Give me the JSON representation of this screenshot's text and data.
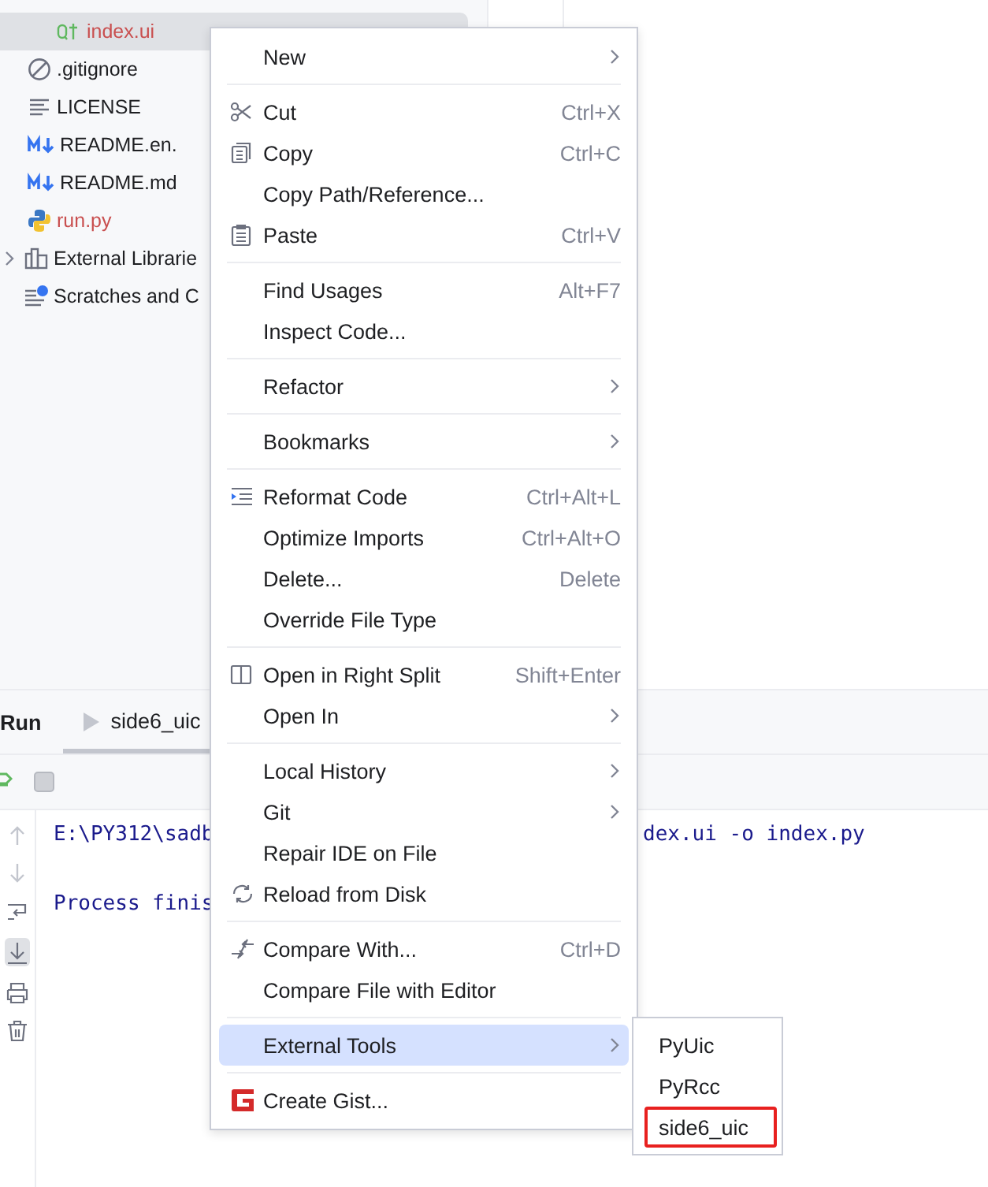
{
  "project_tree": [
    {
      "children": [
        {
          "children": [
            {
              "label": "index.ui",
              "kind": "qt",
              "color": "#c94f4f",
              "selected": true
            }
          ]
        },
        {
          "label": ".gitignore",
          "kind": "ignore",
          "color": "#1e1f22",
          "selected": false
        },
        {
          "label": "LICENSE",
          "kind": "text",
          "color": "#1e1f22",
          "selected": false
        },
        {
          "label": "README.en.",
          "kind": "markdown",
          "color": "#1e1f22",
          "selected": false
        },
        {
          "label": "README.md",
          "kind": "markdown",
          "color": "#1e1f22",
          "selected": false
        },
        {
          "label": "run.py",
          "kind": "python",
          "color": "#c94f4f",
          "selected": false
        }
      ]
    },
    {
      "label": "External Librarie",
      "kind": "libraries",
      "color": "#1e1f22",
      "selected": false,
      "expanded": false
    },
    {
      "label": "Scratches and C",
      "kind": "scratches",
      "color": "#1e1f22",
      "selected": false
    }
  ],
  "run_panel": {
    "title": "Run",
    "tabs": [
      {
        "label": "side6_uic",
        "selected": true
      }
    ],
    "console": [
      {
        "kind": "line",
        "text": "E:\\PY312\\sadb",
        "tail": "dex.ui -o index.py"
      },
      {
        "kind": "blank"
      },
      {
        "kind": "line",
        "text": "Process finis"
      }
    ]
  },
  "context_menu": {
    "items": [
      {
        "kind": "item",
        "label": "New",
        "has_submenu": true,
        "selected": false
      },
      {
        "kind": "separator"
      },
      {
        "kind": "item",
        "label": "Cut",
        "shortcut": "Ctrl+X",
        "selected": false
      },
      {
        "kind": "item",
        "label": "Copy",
        "shortcut": "Ctrl+C",
        "selected": false
      },
      {
        "kind": "item",
        "label": "Copy Path/Reference...",
        "selected": false
      },
      {
        "kind": "item",
        "label": "Paste",
        "shortcut": "Ctrl+V",
        "selected": false
      },
      {
        "kind": "separator"
      },
      {
        "kind": "item",
        "label": "Find Usages",
        "shortcut": "Alt+F7",
        "selected": false
      },
      {
        "kind": "item",
        "label": "Inspect Code...",
        "selected": false
      },
      {
        "kind": "separator"
      },
      {
        "kind": "item",
        "label": "Refactor",
        "has_submenu": true,
        "selected": false
      },
      {
        "kind": "separator"
      },
      {
        "kind": "item",
        "label": "Bookmarks",
        "has_submenu": true,
        "selected": false
      },
      {
        "kind": "separator"
      },
      {
        "kind": "item",
        "label": "Reformat Code",
        "shortcut": "Ctrl+Alt+L",
        "selected": false
      },
      {
        "kind": "item",
        "label": "Optimize Imports",
        "shortcut": "Ctrl+Alt+O",
        "selected": false
      },
      {
        "kind": "item",
        "label": "Delete...",
        "shortcut": "Delete",
        "selected": false
      },
      {
        "kind": "item",
        "label": "Override File Type",
        "selected": false
      },
      {
        "kind": "separator"
      },
      {
        "kind": "item",
        "label": "Open in Right Split",
        "shortcut": "Shift+Enter",
        "selected": false
      },
      {
        "kind": "item",
        "label": "Open In",
        "has_submenu": true,
        "selected": false
      },
      {
        "kind": "separator"
      },
      {
        "kind": "item",
        "label": "Local History",
        "has_submenu": true,
        "selected": false
      },
      {
        "kind": "item",
        "label": "Git",
        "has_submenu": true,
        "selected": false
      },
      {
        "kind": "item",
        "label": "Repair IDE on File",
        "selected": false
      },
      {
        "kind": "item",
        "label": "Reload from Disk",
        "selected": false
      },
      {
        "kind": "separator"
      },
      {
        "kind": "item",
        "label": "Compare With...",
        "shortcut": "Ctrl+D",
        "selected": false
      },
      {
        "kind": "item",
        "label": "Compare File with Editor",
        "selected": false
      },
      {
        "kind": "separator"
      },
      {
        "kind": "item",
        "label": "External Tools",
        "has_submenu": true,
        "selected": true
      },
      {
        "kind": "separator"
      },
      {
        "kind": "item",
        "label": "Create Gist...",
        "selected": false
      }
    ]
  },
  "submenu": {
    "items": [
      {
        "label": "PyUic",
        "outlined": false
      },
      {
        "label": "PyRcc",
        "outlined": false
      },
      {
        "label": "side6_uic",
        "outlined": true
      }
    ]
  }
}
